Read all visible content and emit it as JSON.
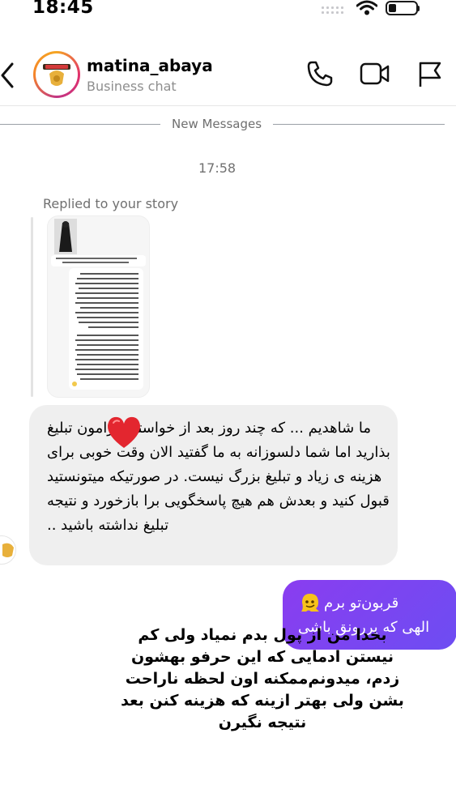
{
  "status_bar": {
    "time": "18:45",
    "battery_level": 0.2
  },
  "header": {
    "username": "matina_abaya",
    "subtitle": "Business chat",
    "icons": [
      "back-chevron-icon",
      "phone-icon",
      "video-icon",
      "flag-icon"
    ]
  },
  "divider": {
    "label": "New Messages"
  },
  "thread": {
    "timestamp": "17:58",
    "replied_label": "Replied to your story",
    "received_message": "ما شاهدیم ... که چند روز بعد از خواستیم برامون تبلیغ بذارید اما شما دلسوزانه به ما گفتید الان وقت خوبی برای هزینه ی زیاد و تبلیغ بزرگ نیست. در صورتیکه میتونستید قبول کنید و بعدش هم هیچ پاسخگویی برا بازخورد و نتیجه تبلیغ نداشته باشید ..",
    "sent_message": {
      "line1": "قربون‌تو برم",
      "line2": "الهی که پررونق  باشی"
    },
    "note": "بخدا من از پول بدم نمیاد ولی کم نیستن ادمایی که این حرفو بهشون زدم، میدونم‌ممکنه اون لحظه ناراحت بشن ولی بهتر ازینه که هزینه کنن بعد نتیجه نگیرن"
  },
  "colors": {
    "sent_bubble": "#7a3cf3",
    "received_bubble": "#efefef",
    "heart": "#e3262f"
  }
}
